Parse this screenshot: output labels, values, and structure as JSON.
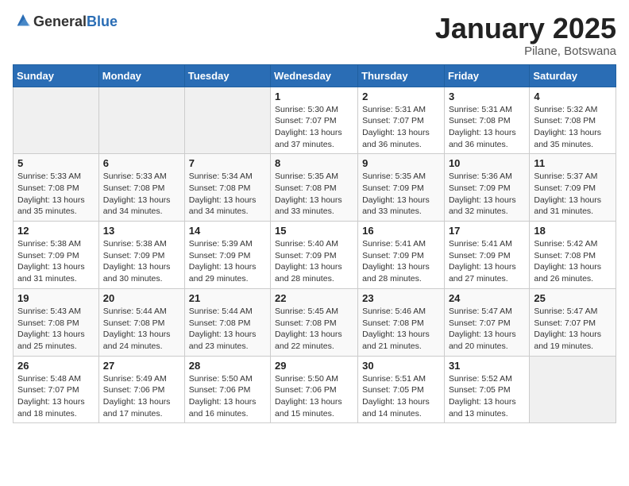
{
  "logo": {
    "general": "General",
    "blue": "Blue"
  },
  "header": {
    "title": "January 2025",
    "subtitle": "Pilane, Botswana"
  },
  "weekdays": [
    "Sunday",
    "Monday",
    "Tuesday",
    "Wednesday",
    "Thursday",
    "Friday",
    "Saturday"
  ],
  "weeks": [
    [
      {
        "day": "",
        "info": ""
      },
      {
        "day": "",
        "info": ""
      },
      {
        "day": "",
        "info": ""
      },
      {
        "day": "1",
        "info": "Sunrise: 5:30 AM\nSunset: 7:07 PM\nDaylight: 13 hours\nand 37 minutes."
      },
      {
        "day": "2",
        "info": "Sunrise: 5:31 AM\nSunset: 7:07 PM\nDaylight: 13 hours\nand 36 minutes."
      },
      {
        "day": "3",
        "info": "Sunrise: 5:31 AM\nSunset: 7:08 PM\nDaylight: 13 hours\nand 36 minutes."
      },
      {
        "day": "4",
        "info": "Sunrise: 5:32 AM\nSunset: 7:08 PM\nDaylight: 13 hours\nand 35 minutes."
      }
    ],
    [
      {
        "day": "5",
        "info": "Sunrise: 5:33 AM\nSunset: 7:08 PM\nDaylight: 13 hours\nand 35 minutes."
      },
      {
        "day": "6",
        "info": "Sunrise: 5:33 AM\nSunset: 7:08 PM\nDaylight: 13 hours\nand 34 minutes."
      },
      {
        "day": "7",
        "info": "Sunrise: 5:34 AM\nSunset: 7:08 PM\nDaylight: 13 hours\nand 34 minutes."
      },
      {
        "day": "8",
        "info": "Sunrise: 5:35 AM\nSunset: 7:08 PM\nDaylight: 13 hours\nand 33 minutes."
      },
      {
        "day": "9",
        "info": "Sunrise: 5:35 AM\nSunset: 7:09 PM\nDaylight: 13 hours\nand 33 minutes."
      },
      {
        "day": "10",
        "info": "Sunrise: 5:36 AM\nSunset: 7:09 PM\nDaylight: 13 hours\nand 32 minutes."
      },
      {
        "day": "11",
        "info": "Sunrise: 5:37 AM\nSunset: 7:09 PM\nDaylight: 13 hours\nand 31 minutes."
      }
    ],
    [
      {
        "day": "12",
        "info": "Sunrise: 5:38 AM\nSunset: 7:09 PM\nDaylight: 13 hours\nand 31 minutes."
      },
      {
        "day": "13",
        "info": "Sunrise: 5:38 AM\nSunset: 7:09 PM\nDaylight: 13 hours\nand 30 minutes."
      },
      {
        "day": "14",
        "info": "Sunrise: 5:39 AM\nSunset: 7:09 PM\nDaylight: 13 hours\nand 29 minutes."
      },
      {
        "day": "15",
        "info": "Sunrise: 5:40 AM\nSunset: 7:09 PM\nDaylight: 13 hours\nand 28 minutes."
      },
      {
        "day": "16",
        "info": "Sunrise: 5:41 AM\nSunset: 7:09 PM\nDaylight: 13 hours\nand 28 minutes."
      },
      {
        "day": "17",
        "info": "Sunrise: 5:41 AM\nSunset: 7:09 PM\nDaylight: 13 hours\nand 27 minutes."
      },
      {
        "day": "18",
        "info": "Sunrise: 5:42 AM\nSunset: 7:08 PM\nDaylight: 13 hours\nand 26 minutes."
      }
    ],
    [
      {
        "day": "19",
        "info": "Sunrise: 5:43 AM\nSunset: 7:08 PM\nDaylight: 13 hours\nand 25 minutes."
      },
      {
        "day": "20",
        "info": "Sunrise: 5:44 AM\nSunset: 7:08 PM\nDaylight: 13 hours\nand 24 minutes."
      },
      {
        "day": "21",
        "info": "Sunrise: 5:44 AM\nSunset: 7:08 PM\nDaylight: 13 hours\nand 23 minutes."
      },
      {
        "day": "22",
        "info": "Sunrise: 5:45 AM\nSunset: 7:08 PM\nDaylight: 13 hours\nand 22 minutes."
      },
      {
        "day": "23",
        "info": "Sunrise: 5:46 AM\nSunset: 7:08 PM\nDaylight: 13 hours\nand 21 minutes."
      },
      {
        "day": "24",
        "info": "Sunrise: 5:47 AM\nSunset: 7:07 PM\nDaylight: 13 hours\nand 20 minutes."
      },
      {
        "day": "25",
        "info": "Sunrise: 5:47 AM\nSunset: 7:07 PM\nDaylight: 13 hours\nand 19 minutes."
      }
    ],
    [
      {
        "day": "26",
        "info": "Sunrise: 5:48 AM\nSunset: 7:07 PM\nDaylight: 13 hours\nand 18 minutes."
      },
      {
        "day": "27",
        "info": "Sunrise: 5:49 AM\nSunset: 7:06 PM\nDaylight: 13 hours\nand 17 minutes."
      },
      {
        "day": "28",
        "info": "Sunrise: 5:50 AM\nSunset: 7:06 PM\nDaylight: 13 hours\nand 16 minutes."
      },
      {
        "day": "29",
        "info": "Sunrise: 5:50 AM\nSunset: 7:06 PM\nDaylight: 13 hours\nand 15 minutes."
      },
      {
        "day": "30",
        "info": "Sunrise: 5:51 AM\nSunset: 7:05 PM\nDaylight: 13 hours\nand 14 minutes."
      },
      {
        "day": "31",
        "info": "Sunrise: 5:52 AM\nSunset: 7:05 PM\nDaylight: 13 hours\nand 13 minutes."
      },
      {
        "day": "",
        "info": ""
      }
    ]
  ]
}
